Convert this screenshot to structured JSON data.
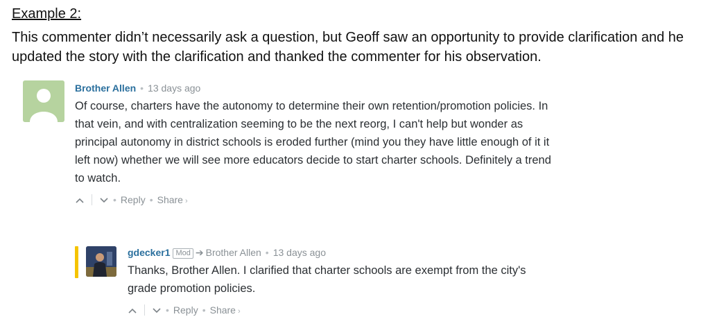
{
  "heading": "Example 2:",
  "intro": "This commenter didn’t necessarily ask a question, but Geoff saw an opportunity to provide clarification and he updated the story with the clarification and thanked the commenter for his observation.",
  "comment1": {
    "author": "Brother Allen",
    "time": "13 days ago",
    "text": "Of course, charters have the autonomy to determine their own retention/promotion policies. In that vein, and with centralization seeming to be the next reorg, I can't help but wonder as principal autonomy in district schools is eroded further (mind you they have little enough of it it left now) whether we will see more educators decide to start charter schools. Definitely a trend to watch.",
    "reply": "Reply",
    "share": "Share"
  },
  "comment2": {
    "author": "gdecker1",
    "badge": "Mod",
    "reply_to": "Brother Allen",
    "time": "13 days ago",
    "text": "Thanks, Brother Allen. I clarified that charter schools are exempt from the city's grade promotion policies.",
    "reply": "Reply",
    "share": "Share"
  },
  "icons": {
    "upvote": "chevron-up-icon",
    "downvote": "chevron-down-icon",
    "reply_arrow": "arrow-right-icon"
  },
  "colors": {
    "author": "#2a6f9d",
    "mod_bar": "#f5c400",
    "avatar_placeholder": "#b6d39f"
  }
}
